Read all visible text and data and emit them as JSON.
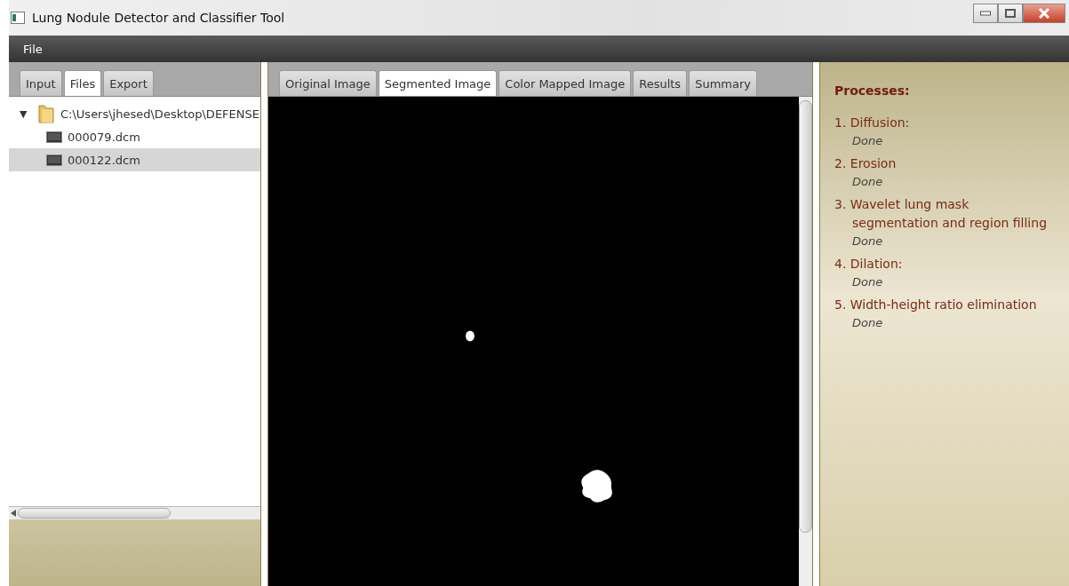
{
  "window": {
    "title": "Lung Nodule Detector and Classifier Tool"
  },
  "menu": [
    "File"
  ],
  "left_tabs": [
    {
      "label": "Input",
      "selected": false
    },
    {
      "label": "Files",
      "selected": true
    },
    {
      "label": "Export",
      "selected": false
    }
  ],
  "tree": {
    "label": "C:\\Users\\jhesed\\Desktop\\DEFENSE",
    "expanded": true,
    "toggle": "▼",
    "children": [
      {
        "label": "000079.dcm",
        "selected": false
      },
      {
        "label": "000122.dcm",
        "selected": true
      }
    ]
  },
  "image_tabs": [
    {
      "label": "Original Image",
      "selected": false
    },
    {
      "label": "Segmented Image",
      "selected": true
    },
    {
      "label": "Color Mapped Image",
      "selected": false
    },
    {
      "label": "Results",
      "selected": false
    },
    {
      "label": "Summary",
      "selected": false
    }
  ],
  "processes": {
    "heading": "Processes:",
    "items": [
      {
        "number": "1.",
        "lines": [
          "Diffusion:"
        ],
        "status": "Done"
      },
      {
        "number": "2.",
        "lines": [
          "Erosion"
        ],
        "status": "Done"
      },
      {
        "number": "3.",
        "lines": [
          "Wavelet lung mask",
          "segmentation and region filling"
        ],
        "status": "Done"
      },
      {
        "number": "4.",
        "lines": [
          "Dilation:"
        ],
        "status": "Done"
      },
      {
        "number": "5.",
        "lines": [
          "Width-height ratio elimination"
        ],
        "status": "Done"
      }
    ]
  }
}
